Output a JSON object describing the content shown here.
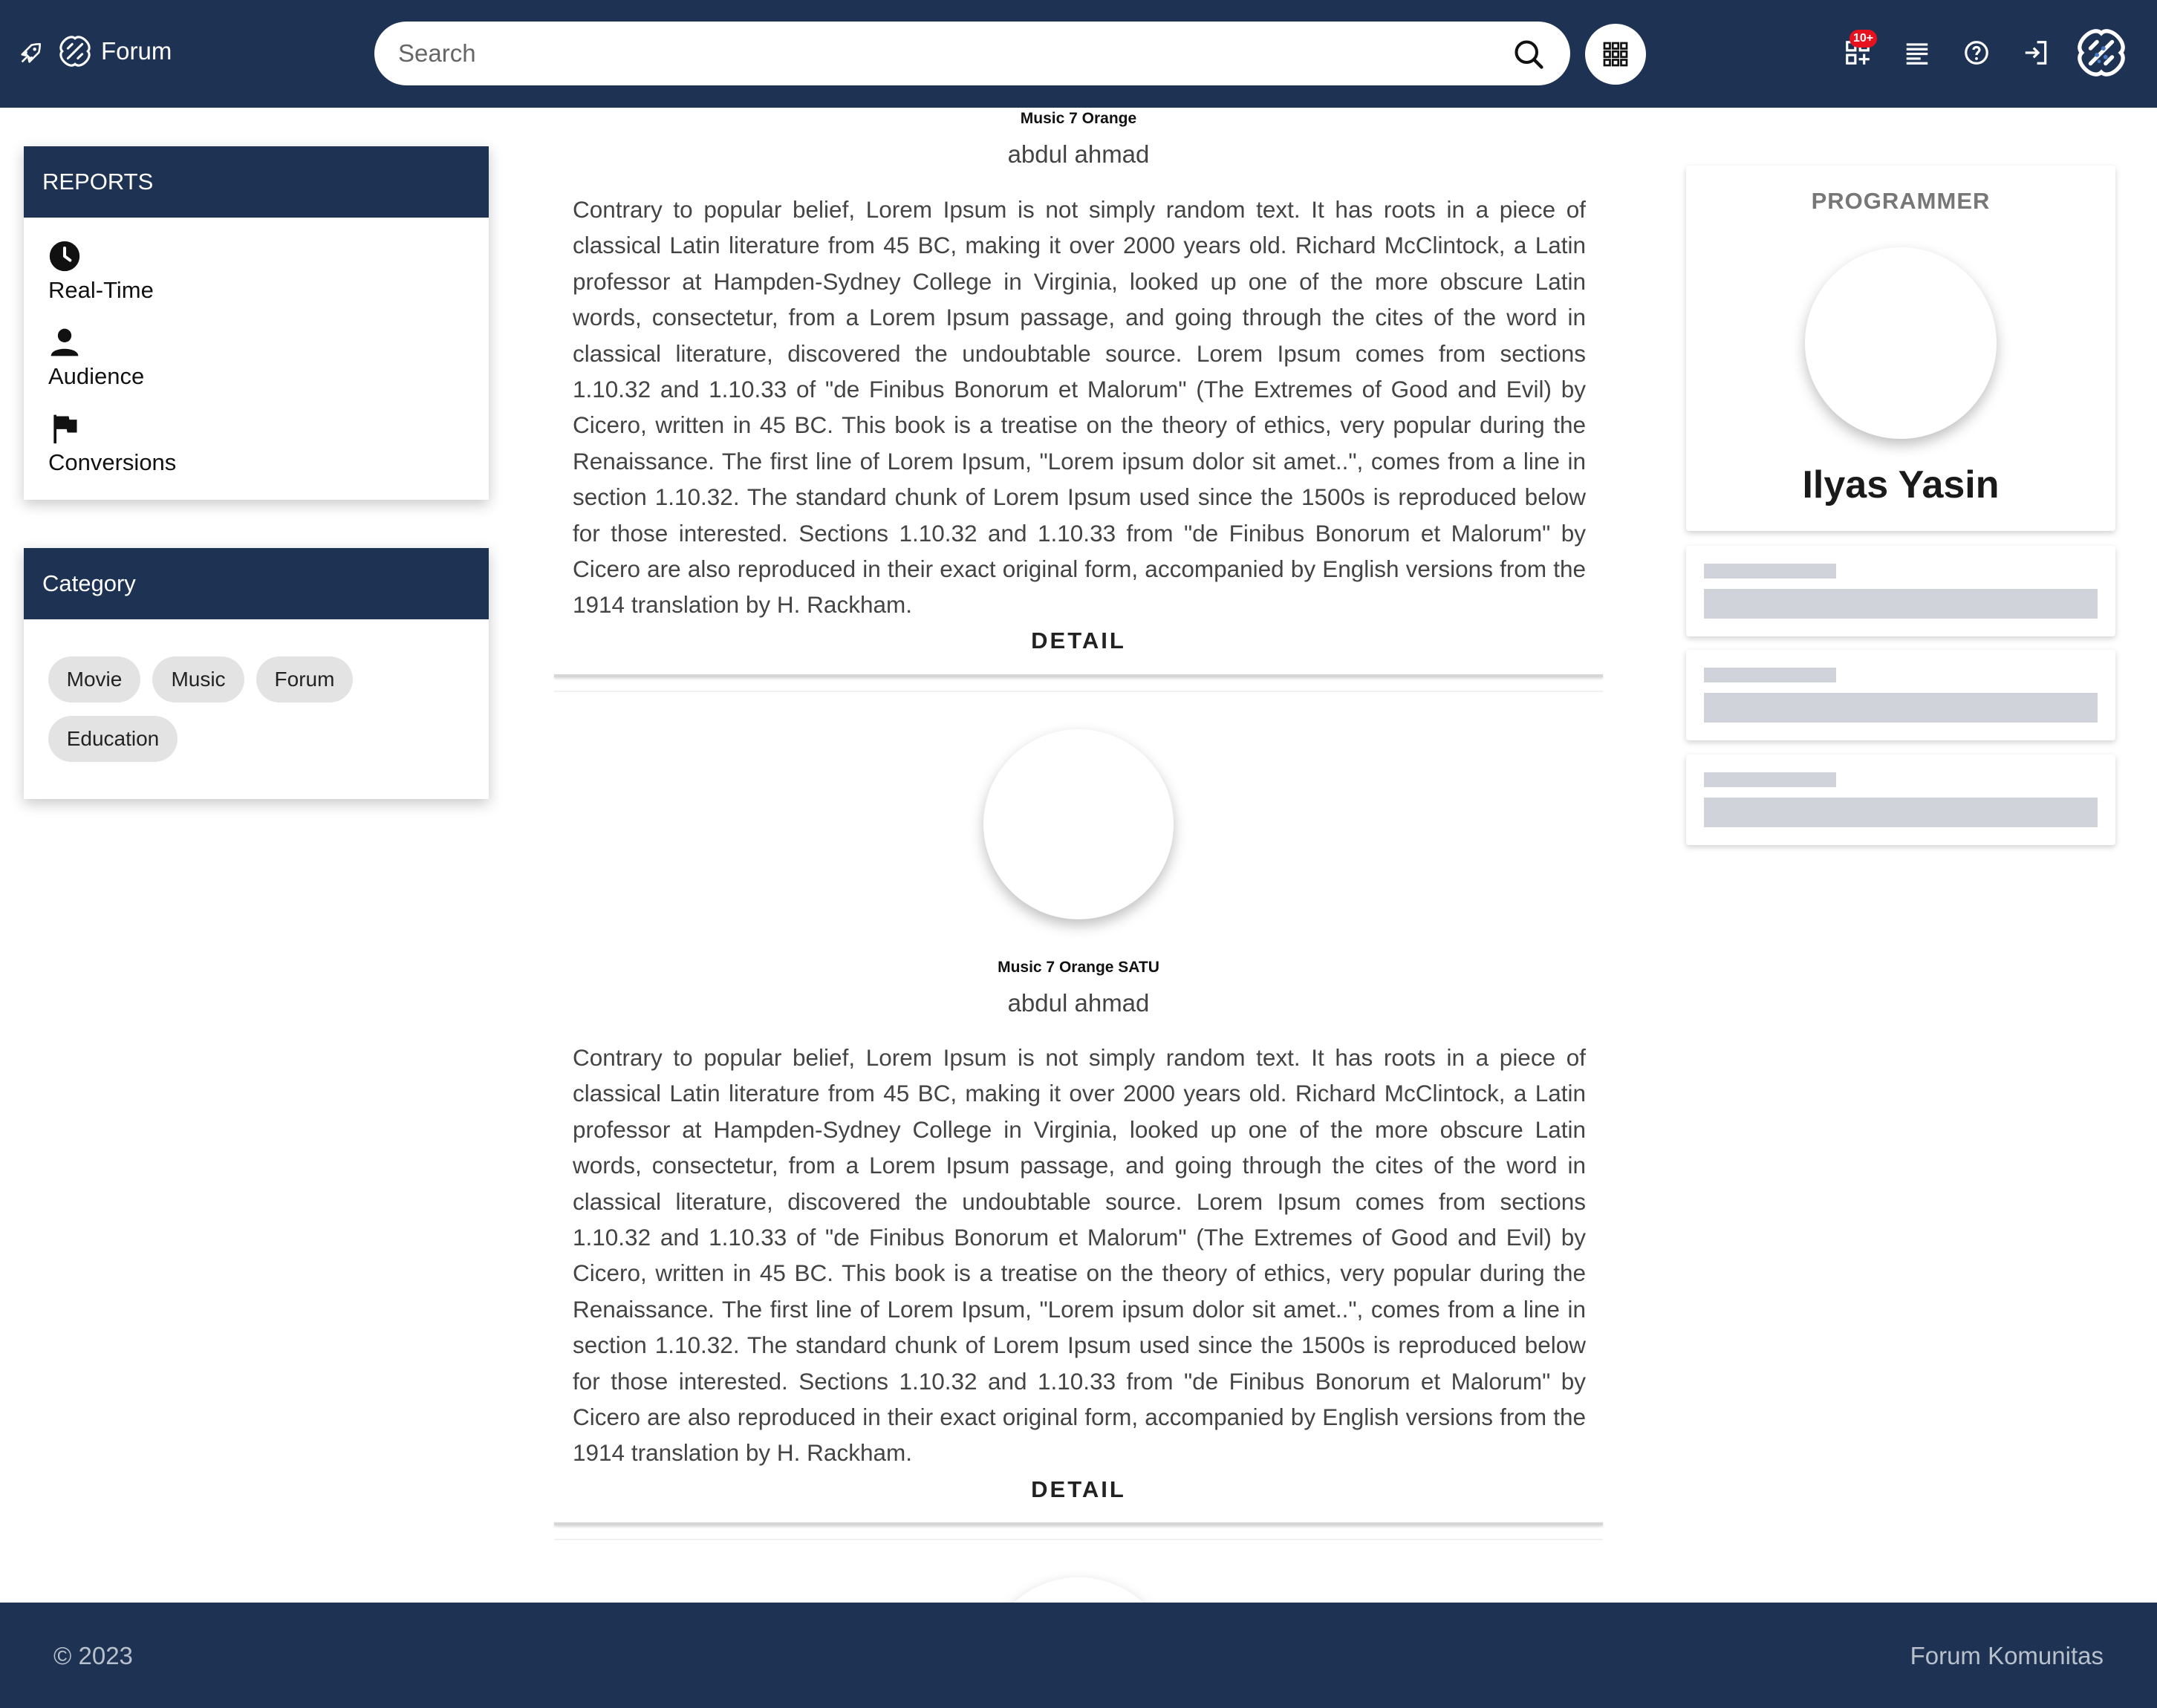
{
  "header": {
    "brand": "Forum",
    "search_placeholder": "Search",
    "notification_badge": "10+"
  },
  "reports": {
    "title": "REPORTS",
    "items": [
      {
        "label": "Real-Time",
        "icon": "clock-icon"
      },
      {
        "label": "Audience",
        "icon": "person-icon"
      },
      {
        "label": "Conversions",
        "icon": "flag-icon"
      }
    ]
  },
  "category": {
    "title": "Category",
    "chips": [
      "Movie",
      "Music",
      "Forum",
      "Education"
    ]
  },
  "posts": [
    {
      "subtitle": "Music 7 Orange",
      "author": "abdul ahmad",
      "body": "Contrary to popular belief, Lorem Ipsum is not simply random text. It has roots in a piece of classical Latin literature from 45 BC, making it over 2000 years old. Richard McClintock, a Latin professor at Hampden-Sydney College in Virginia, looked up one of the more obscure Latin words, consectetur, from a Lorem Ipsum passage, and going through the cites of the word in classical literature, discovered the undoubtable source. Lorem Ipsum comes from sections 1.10.32 and 1.10.33 of \"de Finibus Bonorum et Malorum\" (The Extremes of Good and Evil) by Cicero, written in 45 BC. This book is a treatise on the theory of ethics, very popular during the Renaissance. The first line of Lorem Ipsum, \"Lorem ipsum dolor sit amet..\", comes from a line in section 1.10.32. The standard chunk of Lorem Ipsum used since the 1500s is reproduced below for those interested. Sections 1.10.32 and 1.10.33 from \"de Finibus Bonorum et Malorum\" by Cicero are also reproduced in their exact original form, accompanied by English versions from the 1914 translation by H. Rackham.",
      "detail_label": "DETAIL"
    },
    {
      "subtitle": "Music 7 Orange SATU",
      "author": "abdul ahmad",
      "body": "Contrary to popular belief, Lorem Ipsum is not simply random text. It has roots in a piece of classical Latin literature from 45 BC, making it over 2000 years old. Richard McClintock, a Latin professor at Hampden-Sydney College in Virginia, looked up one of the more obscure Latin words, consectetur, from a Lorem Ipsum passage, and going through the cites of the word in classical literature, discovered the undoubtable source. Lorem Ipsum comes from sections 1.10.32 and 1.10.33 of \"de Finibus Bonorum et Malorum\" (The Extremes of Good and Evil) by Cicero, written in 45 BC. This book is a treatise on the theory of ethics, very popular during the Renaissance. The first line of Lorem Ipsum, \"Lorem ipsum dolor sit amet..\", comes from a line in section 1.10.32. The standard chunk of Lorem Ipsum used since the 1500s is reproduced below for those interested. Sections 1.10.32 and 1.10.33 from \"de Finibus Bonorum et Malorum\" by Cicero are also reproduced in their exact original form, accompanied by English versions from the 1914 translation by H. Rackham.",
      "detail_label": "DETAIL"
    }
  ],
  "profile": {
    "role": "PROGRAMMER",
    "name": "Ilyas Yasin"
  },
  "footer": {
    "copyright": "© 2023",
    "site_name": "Forum Komunitas"
  },
  "colors": {
    "primary": "#1e3353",
    "badge": "#e8121f",
    "chip": "#e3e3e3",
    "skeleton": "#d0d4da"
  }
}
